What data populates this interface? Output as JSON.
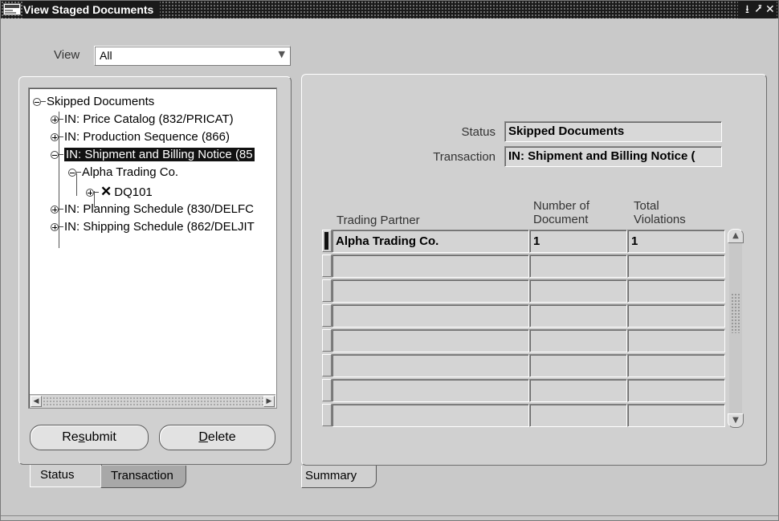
{
  "window": {
    "title": "View Staged Documents",
    "app_icon_text": "",
    "controls": [
      "⭳",
      "⭷",
      "✕"
    ]
  },
  "view": {
    "label": "View",
    "selected": "All"
  },
  "tree": {
    "root": "Skipped Documents",
    "items": [
      "IN: Price Catalog (832/PRICAT)",
      "IN: Production Sequence (866)",
      "IN: Shipment and Billing Notice (85",
      "Alpha Trading Co.",
      "DQ101",
      "IN: Planning Schedule (830/DELFC",
      "IN: Shipping Schedule (862/DELJIT"
    ]
  },
  "buttons": {
    "resubmit_pre": "Re",
    "resubmit_u": "s",
    "resubmit_post": "ubmit",
    "delete_u": "D",
    "delete_post": "elete"
  },
  "left_tabs": [
    "Status",
    "Transaction"
  ],
  "right_tabs": [
    "Summary"
  ],
  "fields": {
    "status_label": "Status",
    "status_value": "Skipped Documents",
    "transaction_label": "Transaction",
    "transaction_value": "IN: Shipment and Billing Notice ("
  },
  "table": {
    "headers": {
      "trading_partner": "Trading Partner",
      "num_docs_line1": "Number of",
      "num_docs_line2": "Document",
      "total_viol_line1": "Total",
      "total_viol_line2": "Violations"
    },
    "rows": [
      [
        "Alpha Trading Co.",
        "1",
        "1"
      ],
      [
        "",
        "",
        ""
      ],
      [
        "",
        "",
        ""
      ],
      [
        "",
        "",
        ""
      ],
      [
        "",
        "",
        ""
      ],
      [
        "",
        "",
        ""
      ],
      [
        "",
        "",
        ""
      ],
      [
        "",
        "",
        ""
      ]
    ]
  }
}
